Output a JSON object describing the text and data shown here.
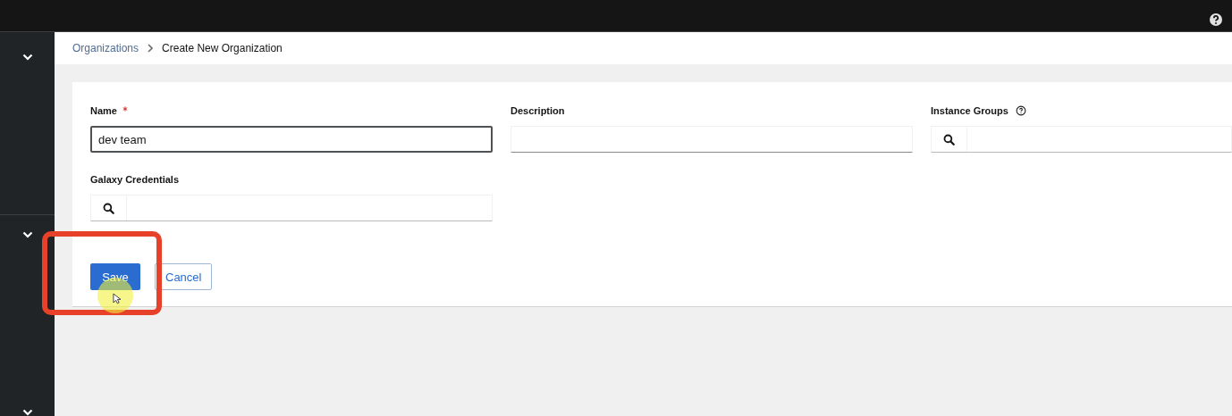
{
  "breadcrumb": [
    {
      "label": "Organizations",
      "kind": "link"
    },
    {
      "label": "Create New Organization",
      "kind": "current"
    }
  ],
  "form": {
    "fields": [
      {
        "label": "Name",
        "required": true,
        "kind": "text",
        "value": "dev team",
        "focused": true
      },
      {
        "label": "Description",
        "kind": "text",
        "focused": false
      },
      {
        "label": "Instance Groups",
        "kind": "lookup",
        "help": true
      },
      {
        "label": "Galaxy Credentials",
        "kind": "lookup"
      }
    ]
  },
  "buttons": [
    {
      "label": "Save",
      "kind": "primary"
    },
    {
      "label": "Cancel",
      "kind": "secondary"
    }
  ]
}
